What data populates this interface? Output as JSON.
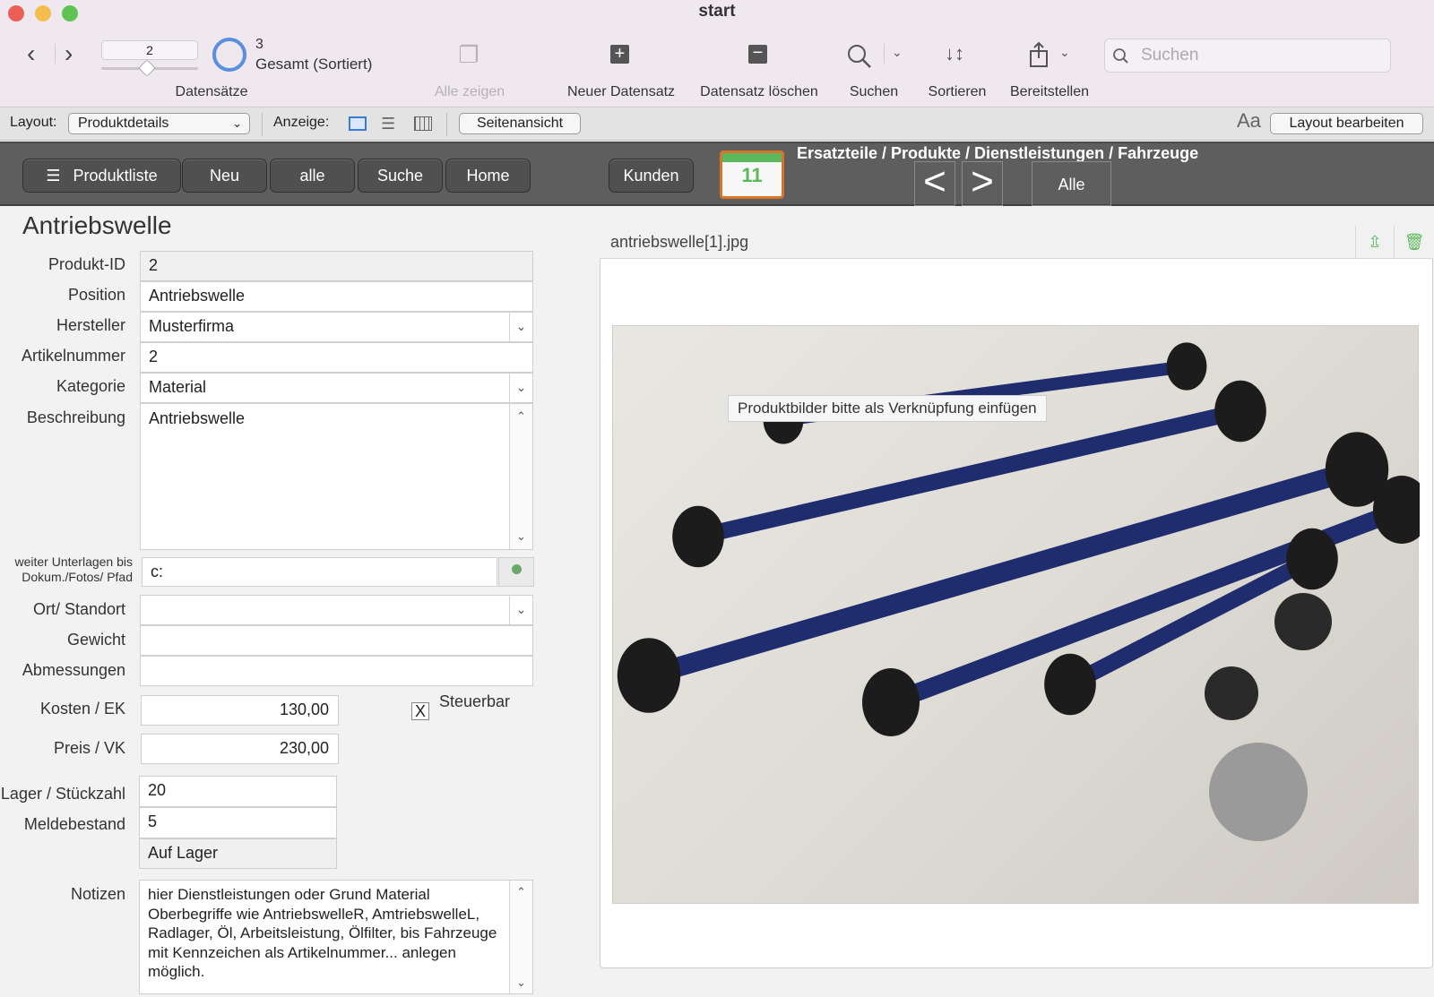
{
  "window": {
    "title": "start"
  },
  "toolbar": {
    "record_value": "2",
    "found_count": "3",
    "found_status": "Gesamt (Sortiert)",
    "records_label": "Datensätze",
    "show_all": "Alle zeigen",
    "new_record": "Neuer Datensatz",
    "delete_record": "Datensatz löschen",
    "search": "Suchen",
    "sort": "Sortieren",
    "share": "Bereitstellen",
    "search_placeholder": "Suchen"
  },
  "layoutbar": {
    "layout_label": "Layout:",
    "layout_value": "Produktdetails",
    "view_label": "Anzeige:",
    "preview_button": "Seitenansicht",
    "font_icon": "Aa",
    "edit_layout": "Layout bearbeiten"
  },
  "nav": {
    "product_list": "Produktliste",
    "new": "Neu",
    "all": "alle",
    "search": "Suche",
    "home": "Home",
    "customers": "Kunden",
    "calendar_day": "11",
    "breadcrumb": "Ersatzteile / Produkte / Dienstleistungen / Fahrzeuge",
    "prev": "<",
    "next": ">",
    "all_box": "Alle"
  },
  "record": {
    "title": "Antriebswelle",
    "fields": {
      "produkt_id": {
        "label": "Produkt-ID",
        "value": "2"
      },
      "position": {
        "label": "Position",
        "value": "Antriebswelle"
      },
      "hersteller": {
        "label": "Hersteller",
        "value": "Musterfirma"
      },
      "artikelnummer": {
        "label": "Artikelnummer",
        "value": "2"
      },
      "kategorie": {
        "label": "Kategorie",
        "value": "Material"
      },
      "beschreibung": {
        "label": "Beschreibung",
        "value": "Antriebswelle"
      },
      "pfad": {
        "label_line1": "weiter Unterlagen bis",
        "label_line2": "Dokum./Fotos/ Pfad",
        "value": "c:"
      },
      "standort": {
        "label": "Ort/ Standort",
        "value": ""
      },
      "gewicht": {
        "label": "Gewicht",
        "value": ""
      },
      "abmessungen": {
        "label": "Abmessungen",
        "value": ""
      },
      "kosten": {
        "label": "Kosten / EK",
        "value": "130,00"
      },
      "steuerbar": {
        "label": "Steuerbar",
        "checked_mark": "X"
      },
      "preis": {
        "label": "Preis / VK",
        "value": "230,00"
      },
      "lager": {
        "label": "Lager / Stückzahl",
        "value": "20"
      },
      "meldebestand": {
        "label": "Meldebestand",
        "value": "5"
      },
      "status": {
        "value": "Auf Lager"
      },
      "notizen": {
        "label": "Notizen",
        "value": "hier Dienstleistungen oder Grund Material Oberbegriffe wie AntriebswelleR, AmtriebswelleL, Radlager, Öl, Arbeitsleistung, Ölfilter, bis Fahrzeuge mit Kennzeichen als Artikelnummer... anlegen möglich."
      }
    }
  },
  "image": {
    "filename": "antriebswelle[1].jpg",
    "tooltip": "Produktbilder bitte als Verknüpfung einfügen"
  },
  "colors": {
    "nav_bar": "#5e5e5e",
    "accent_blue": "#5a8ee0",
    "calendar_orange": "#d7762a",
    "shaft_blue": "#1f2c6e"
  }
}
